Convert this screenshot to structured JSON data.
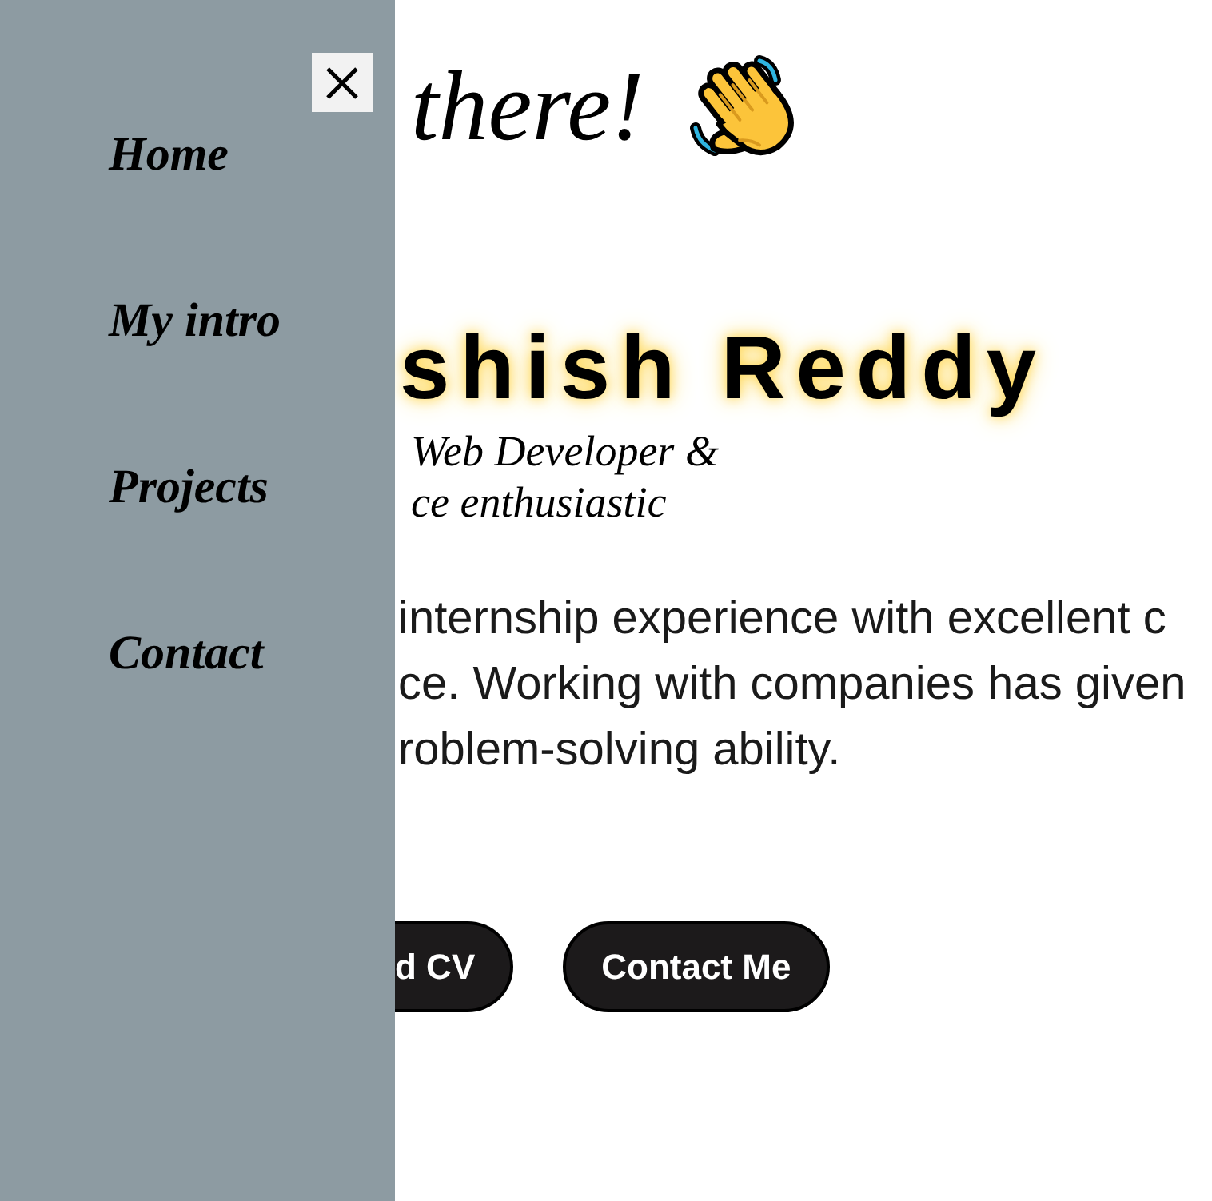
{
  "sidebar": {
    "nav": [
      {
        "label": "Home"
      },
      {
        "label": "My intro"
      },
      {
        "label": "Projects"
      },
      {
        "label": "Contact"
      }
    ]
  },
  "hero": {
    "greeting": "there!",
    "name": "shish Reddy",
    "tagline": "Web Developer &\nce enthusiastic",
    "intro": "internship experience with excellent c\nce. Working with companies has given\nroblem-solving ability.",
    "buttons": [
      {
        "label": "d CV",
        "clipped": true
      },
      {
        "label": "Contact Me",
        "clipped": false
      }
    ]
  }
}
